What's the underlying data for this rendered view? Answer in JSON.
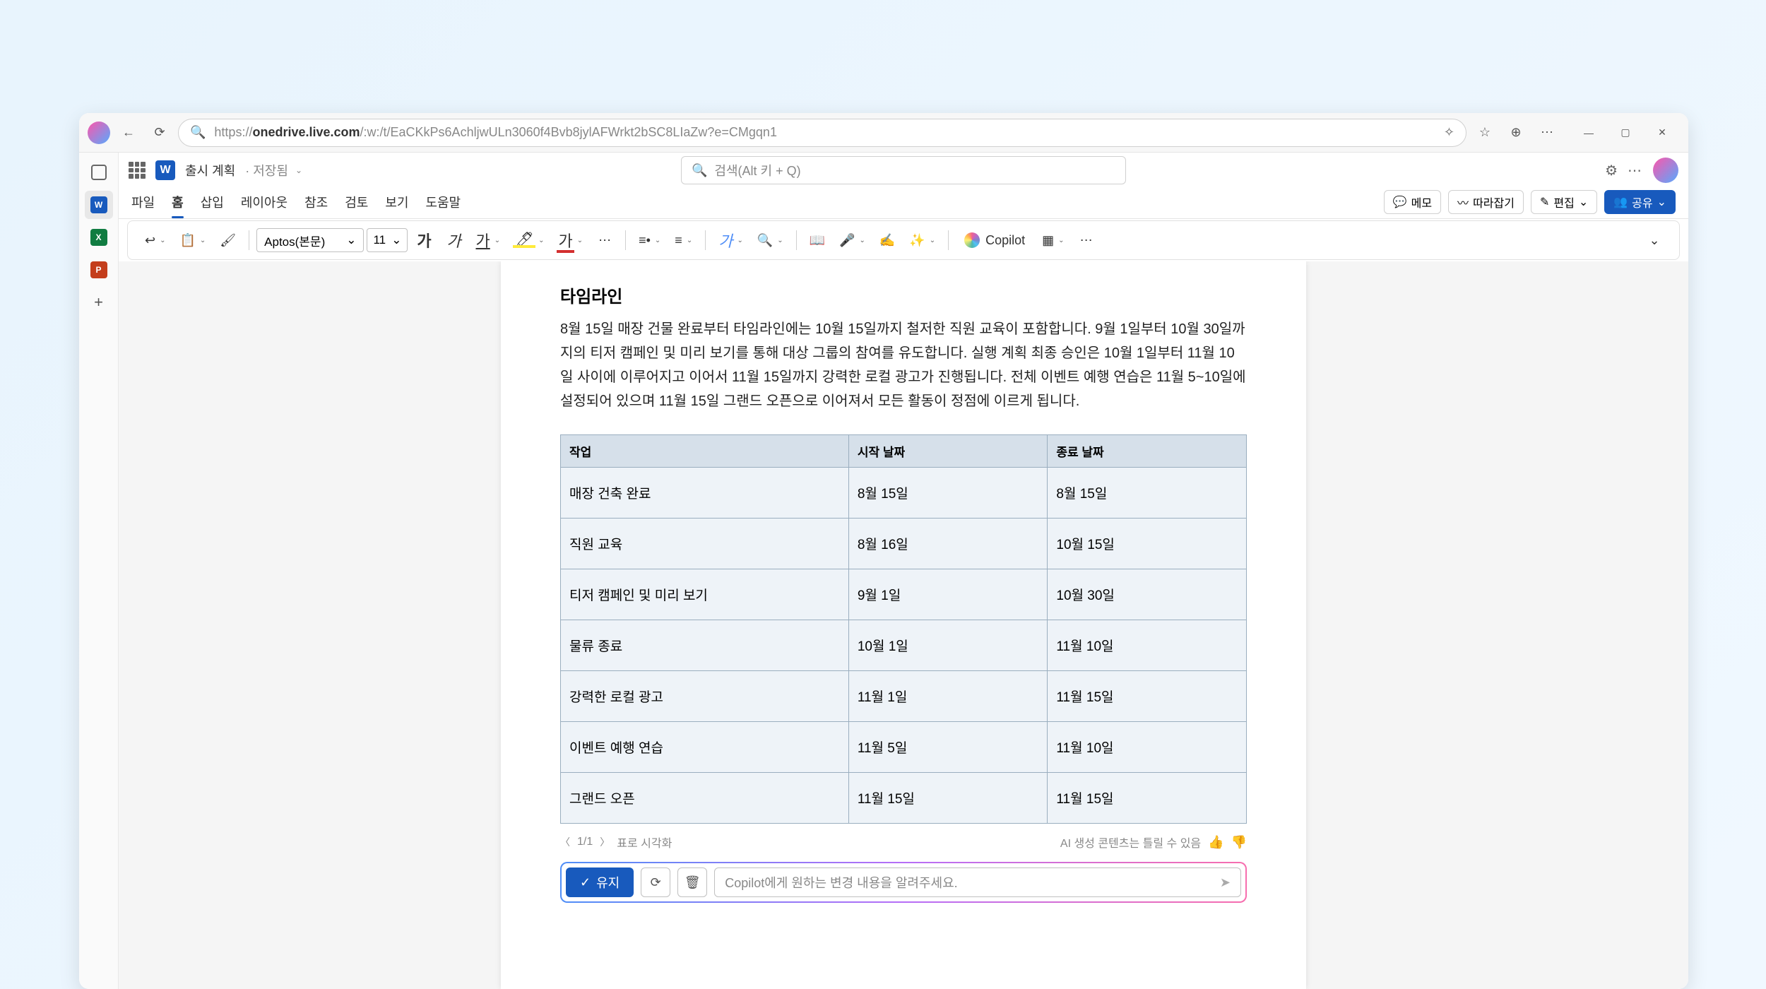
{
  "browser": {
    "url_prefix": "https://",
    "url_bold": "onedrive.live.com",
    "url_rest": "/:w:/t/EaCKkPs6AchljwULn3060f4Bvb8jylAFWrkt2bSC8LIaZw?e=CMgqn1"
  },
  "word": {
    "doc_title": "출시 계획",
    "saved_label": "· 저장됨",
    "search_placeholder": "검색(Alt 키 + Q)",
    "tabs": [
      "파일",
      "홈",
      "삽입",
      "레이아웃",
      "참조",
      "검토",
      "보기",
      "도움말"
    ],
    "active_tab": "홈",
    "memo_label": "메모",
    "catchup_label": "따라잡기",
    "edit_label": "편집",
    "share_label": "공유",
    "font_name": "Aptos(본문)",
    "font_size": "11",
    "copilot_label": "Copilot"
  },
  "document": {
    "heading": "타임라인",
    "paragraph": "8월 15일 매장 건물 완료부터 타임라인에는 10월 15일까지 철저한 직원 교육이 포함합니다. 9월 1일부터 10월 30일까지의 티저 캠페인 및 미리 보기를 통해 대상 그룹의 참여를 유도합니다. 실행 계획 최종 승인은 10월 1일부터 11월 10일 사이에 이루어지고 이어서 11월 15일까지 강력한 로컬 광고가 진행됩니다. 전체 이벤트 예행 연습은 11월 5~10일에 설정되어 있으며 11월 15일 그랜드 오픈으로 이어져서 모든 활동이 정점에 이르게 됩니다.",
    "table": {
      "headers": [
        "작업",
        "시작 날짜",
        "종료 날짜"
      ],
      "rows": [
        [
          "매장 건축 완료",
          "8월 15일",
          "8월 15일"
        ],
        [
          "직원 교육",
          "8월 16일",
          "10월 15일"
        ],
        [
          "티저 캠페인 및 미리 보기",
          "9월 1일",
          "10월 30일"
        ],
        [
          "물류 종료",
          "10월 1일",
          "11월 10일"
        ],
        [
          "강력한 로컬 광고",
          "11월 1일",
          "11월 15일"
        ],
        [
          "이벤트 예행 연습",
          "11월 5일",
          "11월 10일"
        ],
        [
          "그랜드 오픈",
          "11월 15일",
          "11월 15일"
        ]
      ]
    }
  },
  "ai": {
    "page_counter": "1/1",
    "visualize_label": "표로 시각화",
    "disclaimer": "AI 생성 콘텐츠는 틀릴 수 있음",
    "keep_label": "유지",
    "input_placeholder": "Copilot에게 원하는 변경 내용을 알려주세요."
  }
}
